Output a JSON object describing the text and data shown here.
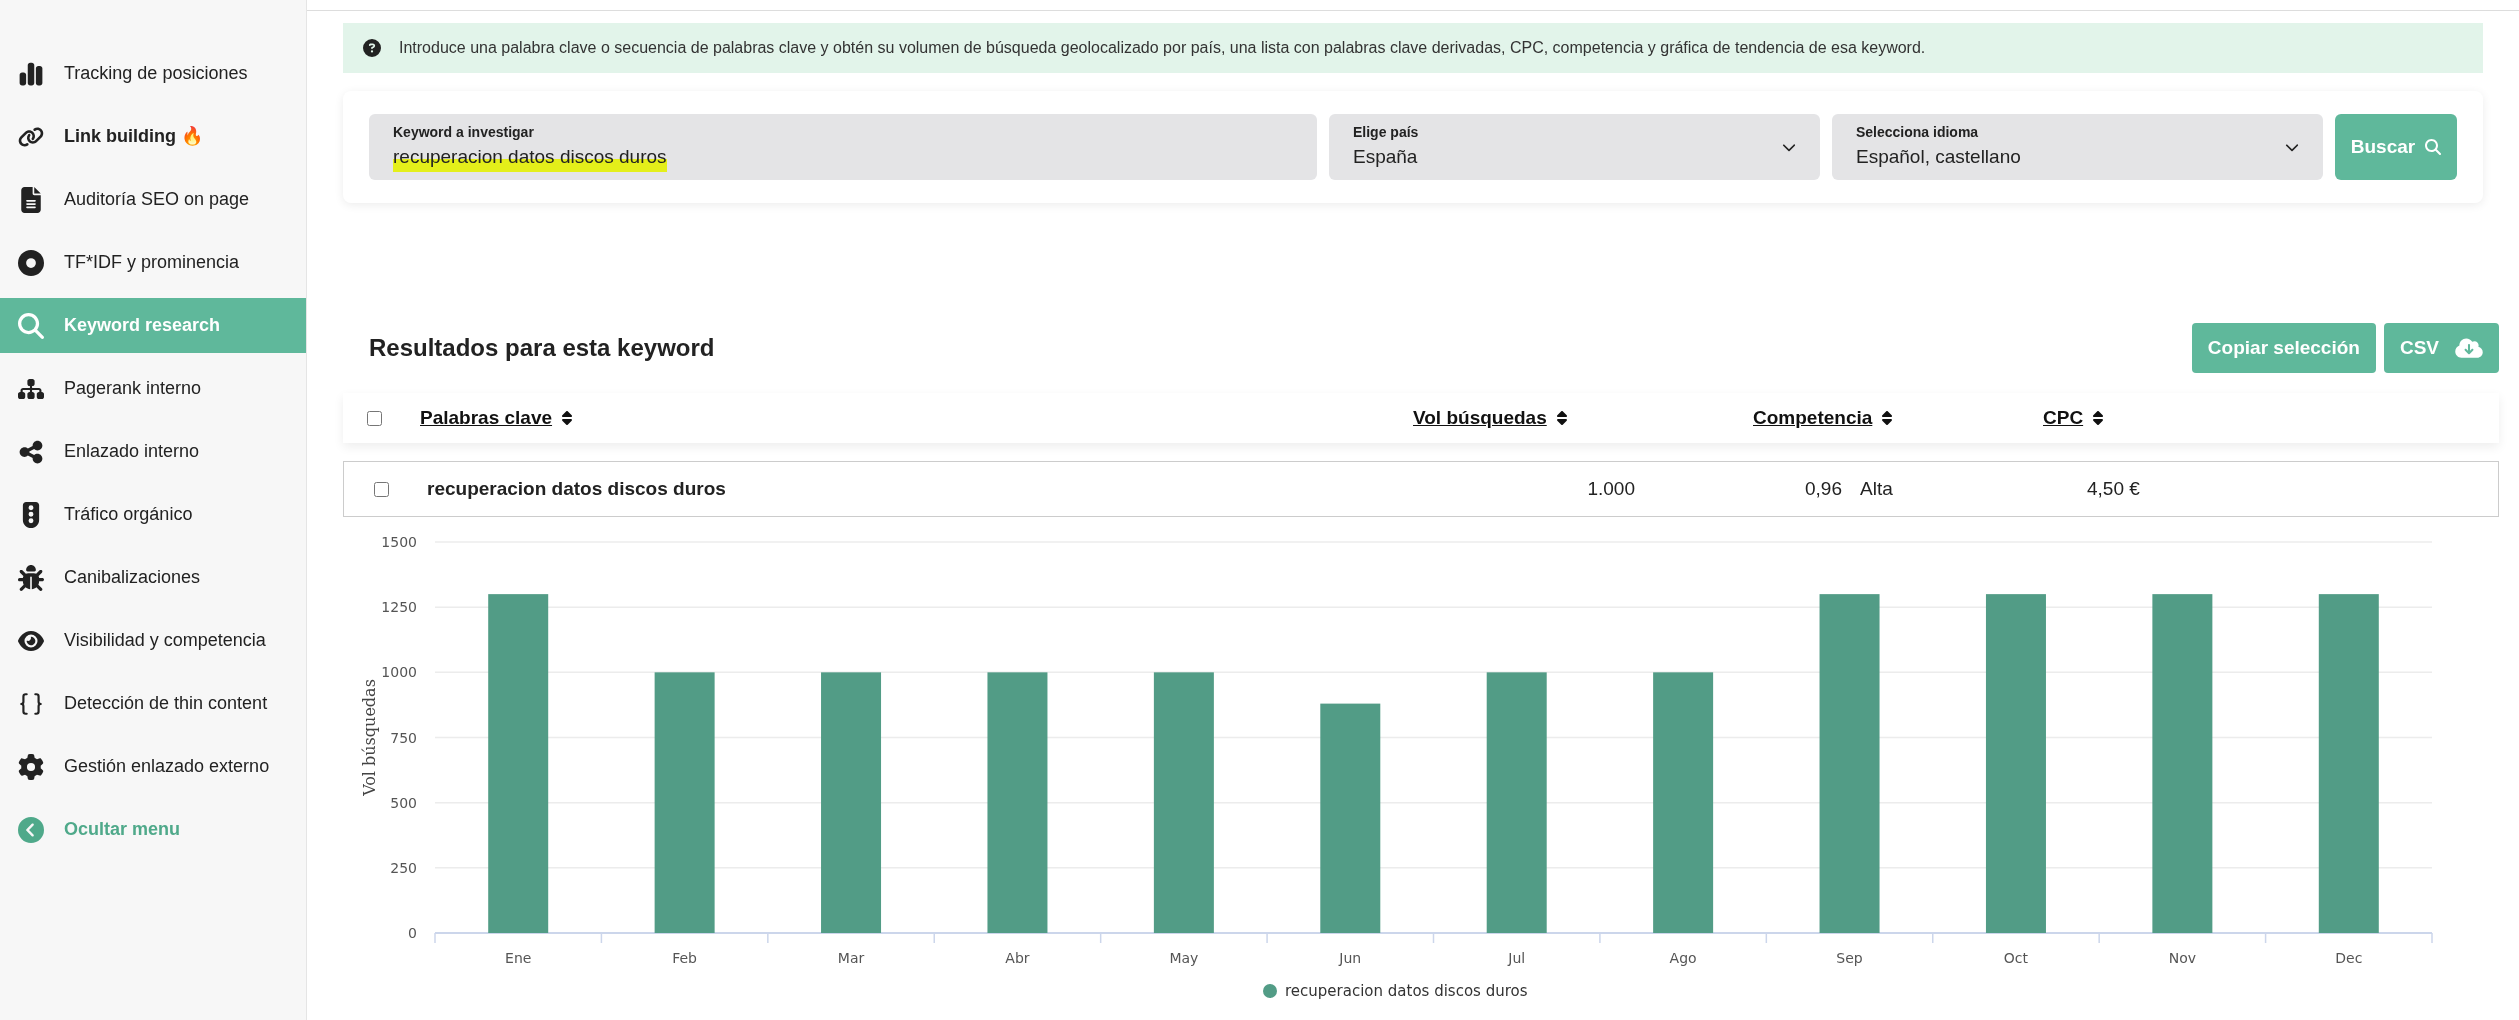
{
  "sidebar": {
    "items": [
      {
        "label": "Tracking de posiciones",
        "selected": false,
        "emphasized": false
      },
      {
        "label": "Link building 🔥",
        "selected": false,
        "emphasized": true
      },
      {
        "label": "Auditoría SEO on page",
        "selected": false,
        "emphasized": false
      },
      {
        "label": "TF*IDF y prominencia",
        "selected": false,
        "emphasized": false
      },
      {
        "label": "Keyword research",
        "selected": true,
        "emphasized": false
      },
      {
        "label": "Pagerank interno",
        "selected": false,
        "emphasized": false
      },
      {
        "label": "Enlazado interno",
        "selected": false,
        "emphasized": false
      },
      {
        "label": "Tráfico orgánico",
        "selected": false,
        "emphasized": false
      },
      {
        "label": "Canibalizaciones",
        "selected": false,
        "emphasized": false
      },
      {
        "label": "Visibilidad y competencia",
        "selected": false,
        "emphasized": false
      },
      {
        "label": "Detección de thin content",
        "selected": false,
        "emphasized": false
      },
      {
        "label": "Gestión enlazado externo",
        "selected": false,
        "emphasized": false
      }
    ],
    "toggle": {
      "label": "Ocultar menu"
    }
  },
  "info_banner": {
    "text": "Introduce una palabra clave o secuencia de palabras clave y obtén su volumen de búsqueda geolocalizado por país, una lista con palabras clave derivadas, CPC, competencia y gráfica de tendencia de esa keyword."
  },
  "search_form": {
    "keyword": {
      "label": "Keyword a investigar",
      "value": "recuperacion datos discos duros"
    },
    "country": {
      "label": "Elige país",
      "value": "España"
    },
    "language": {
      "label": "Selecciona idioma",
      "value": "Español, castellano"
    },
    "button": "Buscar"
  },
  "results": {
    "title": "Resultados para esta keyword",
    "buttons": [
      "Copiar selección",
      "CSV"
    ],
    "table": {
      "header_checked": false,
      "columns": [
        "Palabras clave",
        "Vol búsquedas",
        "Competencia",
        "CPC"
      ],
      "rows": [
        {
          "checked": false,
          "keyword": "recuperacion datos discos duros",
          "volume": "1.000",
          "competition": "0,96",
          "competition_level": "Alta",
          "cpc": "4,50 €"
        }
      ]
    },
    "chart_data": {
      "type": "bar",
      "ylabel": "Vol búsquedas",
      "categories": [
        "Ene",
        "Feb",
        "Mar",
        "Abr",
        "May",
        "Jun",
        "Jul",
        "Ago",
        "Sep",
        "Oct",
        "Nov",
        "Dec"
      ],
      "series": [
        {
          "name": "recuperacion datos discos duros",
          "color": "#529c86",
          "values": [
            1300,
            1000,
            1000,
            1000,
            1000,
            880,
            1000,
            1000,
            1300,
            1300,
            1300,
            1300
          ]
        }
      ],
      "grid": true,
      "ylim": [
        0,
        1500
      ],
      "yticks": [
        0,
        250,
        500,
        750,
        1000,
        1250,
        1500
      ]
    }
  }
}
